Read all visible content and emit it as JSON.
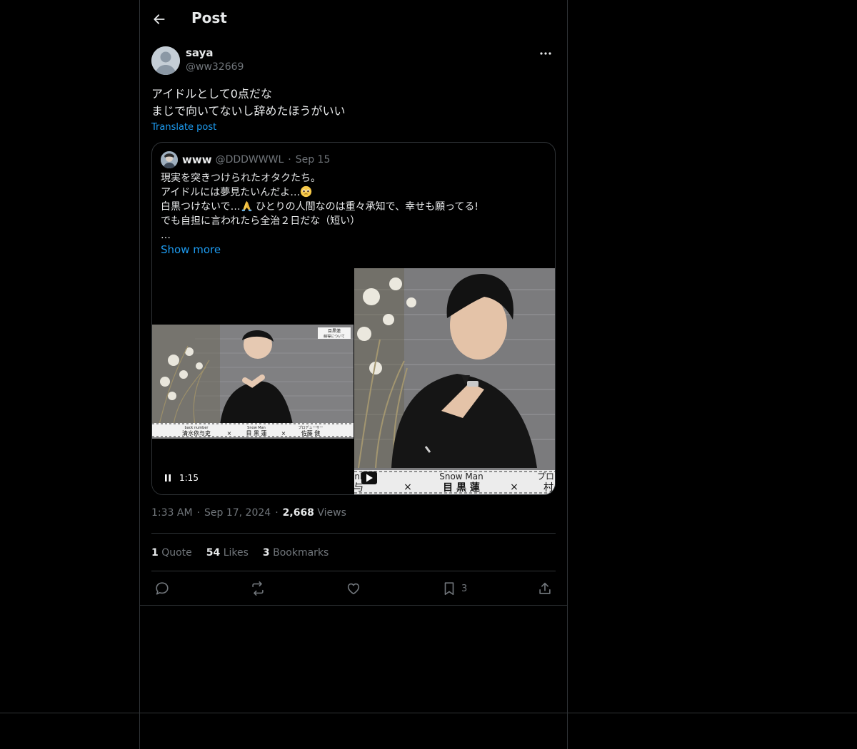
{
  "header": {
    "title": "Post"
  },
  "post": {
    "author": {
      "name": "saya",
      "handle": "@ww32669"
    },
    "text_lines": [
      "アイドルとして0点だな",
      "まじで向いてないし辞めたほうがいい"
    ],
    "translate_label": "Translate post",
    "timestamp": {
      "time": "1:33 AM",
      "separator": "·",
      "date": "Sep 17, 2024",
      "views_count": "2,668",
      "views_label": "Views"
    },
    "stats": {
      "quotes": {
        "count": "1",
        "label": "Quote"
      },
      "likes": {
        "count": "54",
        "label": "Likes"
      },
      "bookmarks": {
        "count": "3",
        "label": "Bookmarks"
      }
    },
    "actions": {
      "bookmark_count": "3"
    }
  },
  "quote": {
    "name": "www",
    "handle": "@DDDWWWL",
    "separator": "·",
    "date": "Sep 15",
    "lines": [
      "現実を突きつけられたオタクたち。",
      "アイドルには夢見たいんだよ…",
      "白黒つけないで…",
      " ひとりの人間なのは重々承知で、幸せも願ってる!",
      "でも自担に言われたら全治２日だな（短い）",
      "…"
    ],
    "show_more": "Show more",
    "video": {
      "duration": "1:15"
    },
    "media": {
      "left_caption": {
        "corner_top": "目黒蓮",
        "corner_bottom": "納得について",
        "band_1": "back number",
        "band_2": "Snow Man",
        "band_3": "プロデューサー",
        "names_1": "清水依与吏",
        "names_2": "目 黒 蓮",
        "names_3": "佐藤 健",
        "cross": "×"
      },
      "right_caption": {
        "band": "Snow Man",
        "band_left": "nb",
        "band_right": "プロ",
        "names": "目 黒 蓮",
        "name_left": "与",
        "name_right": "村",
        "cross": "×"
      }
    }
  },
  "colors": {
    "accent": "#1d9bf0",
    "text": "#e7e9ea",
    "muted": "#71767b",
    "border": "#2f3336",
    "background": "#000000"
  }
}
